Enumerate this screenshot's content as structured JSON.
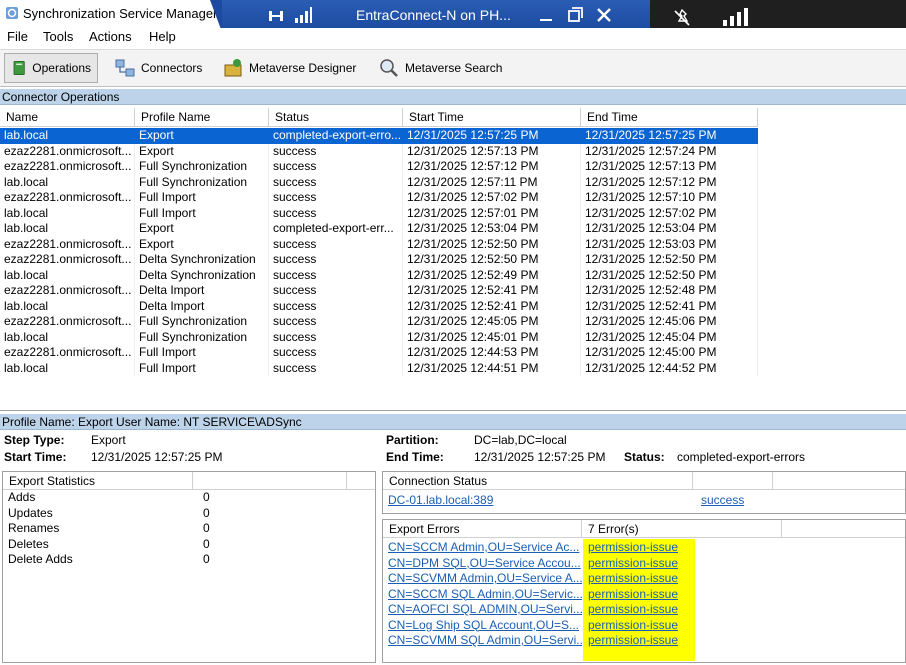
{
  "window": {
    "title": "Synchronization Service Manager",
    "rdp_title": "EntraConnect-N on PH..."
  },
  "menu": [
    "File",
    "Tools",
    "Actions",
    "Help"
  ],
  "toolbar": {
    "operations": "Operations",
    "connectors": "Connectors",
    "metaverse_designer": "Metaverse Designer",
    "metaverse_search": "Metaverse Search"
  },
  "connector_operations": {
    "header": "Connector Operations",
    "columns": [
      "Name",
      "Profile Name",
      "Status",
      "Start Time",
      "End Time"
    ],
    "rows": [
      [
        "lab.local",
        "Export",
        "completed-export-erro...",
        "12/31/2025 12:57:25 PM",
        "12/31/2025 12:57:25 PM"
      ],
      [
        "ezaz2281.onmicrosoft...",
        "Export",
        "success",
        "12/31/2025 12:57:13 PM",
        "12/31/2025 12:57:24 PM"
      ],
      [
        "ezaz2281.onmicrosoft...",
        "Full Synchronization",
        "success",
        "12/31/2025 12:57:12 PM",
        "12/31/2025 12:57:13 PM"
      ],
      [
        "lab.local",
        "Full Synchronization",
        "success",
        "12/31/2025 12:57:11 PM",
        "12/31/2025 12:57:12 PM"
      ],
      [
        "ezaz2281.onmicrosoft...",
        "Full Import",
        "success",
        "12/31/2025 12:57:02 PM",
        "12/31/2025 12:57:10 PM"
      ],
      [
        "lab.local",
        "Full Import",
        "success",
        "12/31/2025 12:57:01 PM",
        "12/31/2025 12:57:02 PM"
      ],
      [
        "lab.local",
        "Export",
        "completed-export-err...",
        "12/31/2025 12:53:04 PM",
        "12/31/2025 12:53:04 PM"
      ],
      [
        "ezaz2281.onmicrosoft...",
        "Export",
        "success",
        "12/31/2025 12:52:50 PM",
        "12/31/2025 12:53:03 PM"
      ],
      [
        "ezaz2281.onmicrosoft...",
        "Delta Synchronization",
        "success",
        "12/31/2025 12:52:50 PM",
        "12/31/2025 12:52:50 PM"
      ],
      [
        "lab.local",
        "Delta Synchronization",
        "success",
        "12/31/2025 12:52:49 PM",
        "12/31/2025 12:52:50 PM"
      ],
      [
        "ezaz2281.onmicrosoft...",
        "Delta Import",
        "success",
        "12/31/2025 12:52:41 PM",
        "12/31/2025 12:52:48 PM"
      ],
      [
        "lab.local",
        "Delta Import",
        "success",
        "12/31/2025 12:52:41 PM",
        "12/31/2025 12:52:41 PM"
      ],
      [
        "ezaz2281.onmicrosoft...",
        "Full Synchronization",
        "success",
        "12/31/2025 12:45:05 PM",
        "12/31/2025 12:45:06 PM"
      ],
      [
        "lab.local",
        "Full Synchronization",
        "success",
        "12/31/2025 12:45:01 PM",
        "12/31/2025 12:45:04 PM"
      ],
      [
        "ezaz2281.onmicrosoft...",
        "Full Import",
        "success",
        "12/31/2025 12:44:53 PM",
        "12/31/2025 12:45:00 PM"
      ],
      [
        "lab.local",
        "Full Import",
        "success",
        "12/31/2025 12:44:51 PM",
        "12/31/2025 12:44:52 PM"
      ]
    ],
    "selected_row": 0
  },
  "details": {
    "header": "Profile Name: Export  User Name: NT SERVICE\\ADSync",
    "step_type_label": "Step Type:",
    "step_type": "Export",
    "start_time_label": "Start Time:",
    "start_time": "12/31/2025 12:57:25 PM",
    "partition_label": "Partition:",
    "partition": "DC=lab,DC=local",
    "end_time_label": "End Time:",
    "end_time": "12/31/2025 12:57:25 PM",
    "status_label": "Status:",
    "status": "completed-export-errors"
  },
  "export_statistics": {
    "header": "Export Statistics",
    "rows": [
      {
        "label": "Adds",
        "value": "0"
      },
      {
        "label": "Updates",
        "value": "0"
      },
      {
        "label": "Renames",
        "value": "0"
      },
      {
        "label": "Deletes",
        "value": "0"
      },
      {
        "label": "Delete Adds",
        "value": "0"
      }
    ]
  },
  "connection_status": {
    "header": "Connection Status",
    "server": "DC-01.lab.local:389",
    "result": "success"
  },
  "export_errors": {
    "header": "Export Errors",
    "count": "7 Error(s)",
    "rows": [
      {
        "dn": "CN=SCCM Admin,OU=Service Ac...",
        "error": "permission-issue"
      },
      {
        "dn": "CN=DPM SQL,OU=Service Accou...",
        "error": "permission-issue"
      },
      {
        "dn": "CN=SCVMM Admin,OU=Service A...",
        "error": "permission-issue"
      },
      {
        "dn": "CN=SCCM SQL Admin,OU=Servic...",
        "error": "permission-issue"
      },
      {
        "dn": "CN=AOFCI SQL ADMIN,OU=Servi...",
        "error": "permission-issue"
      },
      {
        "dn": "CN=Log Ship SQL Account,OU=S...",
        "error": "permission-issue"
      },
      {
        "dn": "CN=SCVMM SQL Admin,OU=Servi...",
        "error": "permission-issue"
      }
    ]
  },
  "colors": {
    "selection": "#0a64d2",
    "section_header": "#bcd3ea",
    "link": "#1a5fb4",
    "highlight": "#ffff00",
    "rdp_bar": "#1c4aa0"
  }
}
